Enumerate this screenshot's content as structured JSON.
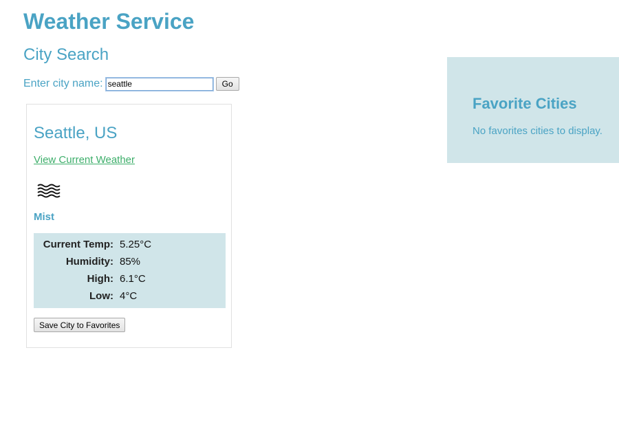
{
  "app": {
    "title": "Weather Service"
  },
  "search": {
    "section_title": "City Search",
    "label": "Enter city name:",
    "value": "seattle",
    "go_label": "Go"
  },
  "result": {
    "city": "Seattle, US",
    "link_text": "View Current Weather",
    "icon": "mist-icon",
    "condition": "Mist",
    "stats": [
      {
        "label": "Current Temp:",
        "value": "5.25°C"
      },
      {
        "label": "Humidity:",
        "value": "85%"
      },
      {
        "label": "High:",
        "value": "6.1°C"
      },
      {
        "label": "Low:",
        "value": "4°C"
      }
    ],
    "save_label": "Save City to Favorites"
  },
  "favorites": {
    "title": "Favorite Cities",
    "empty_message": "No favorites cities to display."
  },
  "colors": {
    "accent": "#4aa3c4",
    "link": "#3dae6a",
    "panel_bg": "#d0e5e9"
  }
}
